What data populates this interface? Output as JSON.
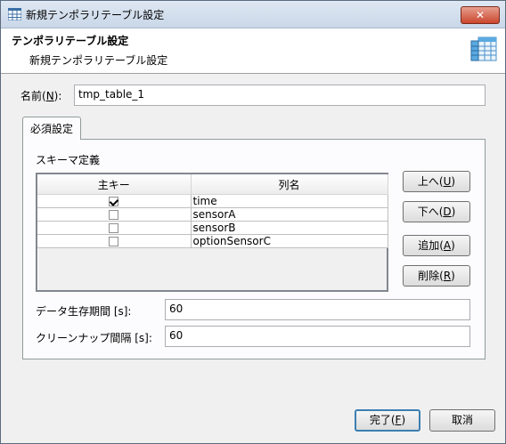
{
  "window": {
    "title": "新規テンポラリテーブル設定",
    "close_label": "✕"
  },
  "header": {
    "title": "テンポラリテーブル設定",
    "subtitle": "新規テンポラリテーブル設定"
  },
  "name_field": {
    "label_prefix": "名前(",
    "label_key": "N",
    "label_suffix": "):",
    "value": "tmp_table_1"
  },
  "tab": {
    "label": "必須設定"
  },
  "schema": {
    "label": "スキーマ定義",
    "columns": [
      "主キー",
      "列名"
    ],
    "rows": [
      {
        "primary_key": true,
        "name": "time"
      },
      {
        "primary_key": false,
        "name": "sensorA"
      },
      {
        "primary_key": false,
        "name": "sensorB"
      },
      {
        "primary_key": false,
        "name": "optionSensorC"
      }
    ]
  },
  "side_buttons": {
    "up": {
      "prefix": "上へ(",
      "key": "U",
      "suffix": ")"
    },
    "down": {
      "prefix": "下へ(",
      "key": "D",
      "suffix": ")"
    },
    "add": {
      "prefix": "追加(",
      "key": "A",
      "suffix": ")"
    },
    "delete": {
      "prefix": "削除(",
      "key": "R",
      "suffix": ")"
    }
  },
  "retention": {
    "label": "データ生存期間 [s]:",
    "value": "60"
  },
  "cleanup": {
    "label": "クリーンナップ間隔 [s]:",
    "value": "60"
  },
  "footer": {
    "finish": {
      "prefix": "完了(",
      "key": "F",
      "suffix": ")"
    },
    "cancel": "取消"
  }
}
